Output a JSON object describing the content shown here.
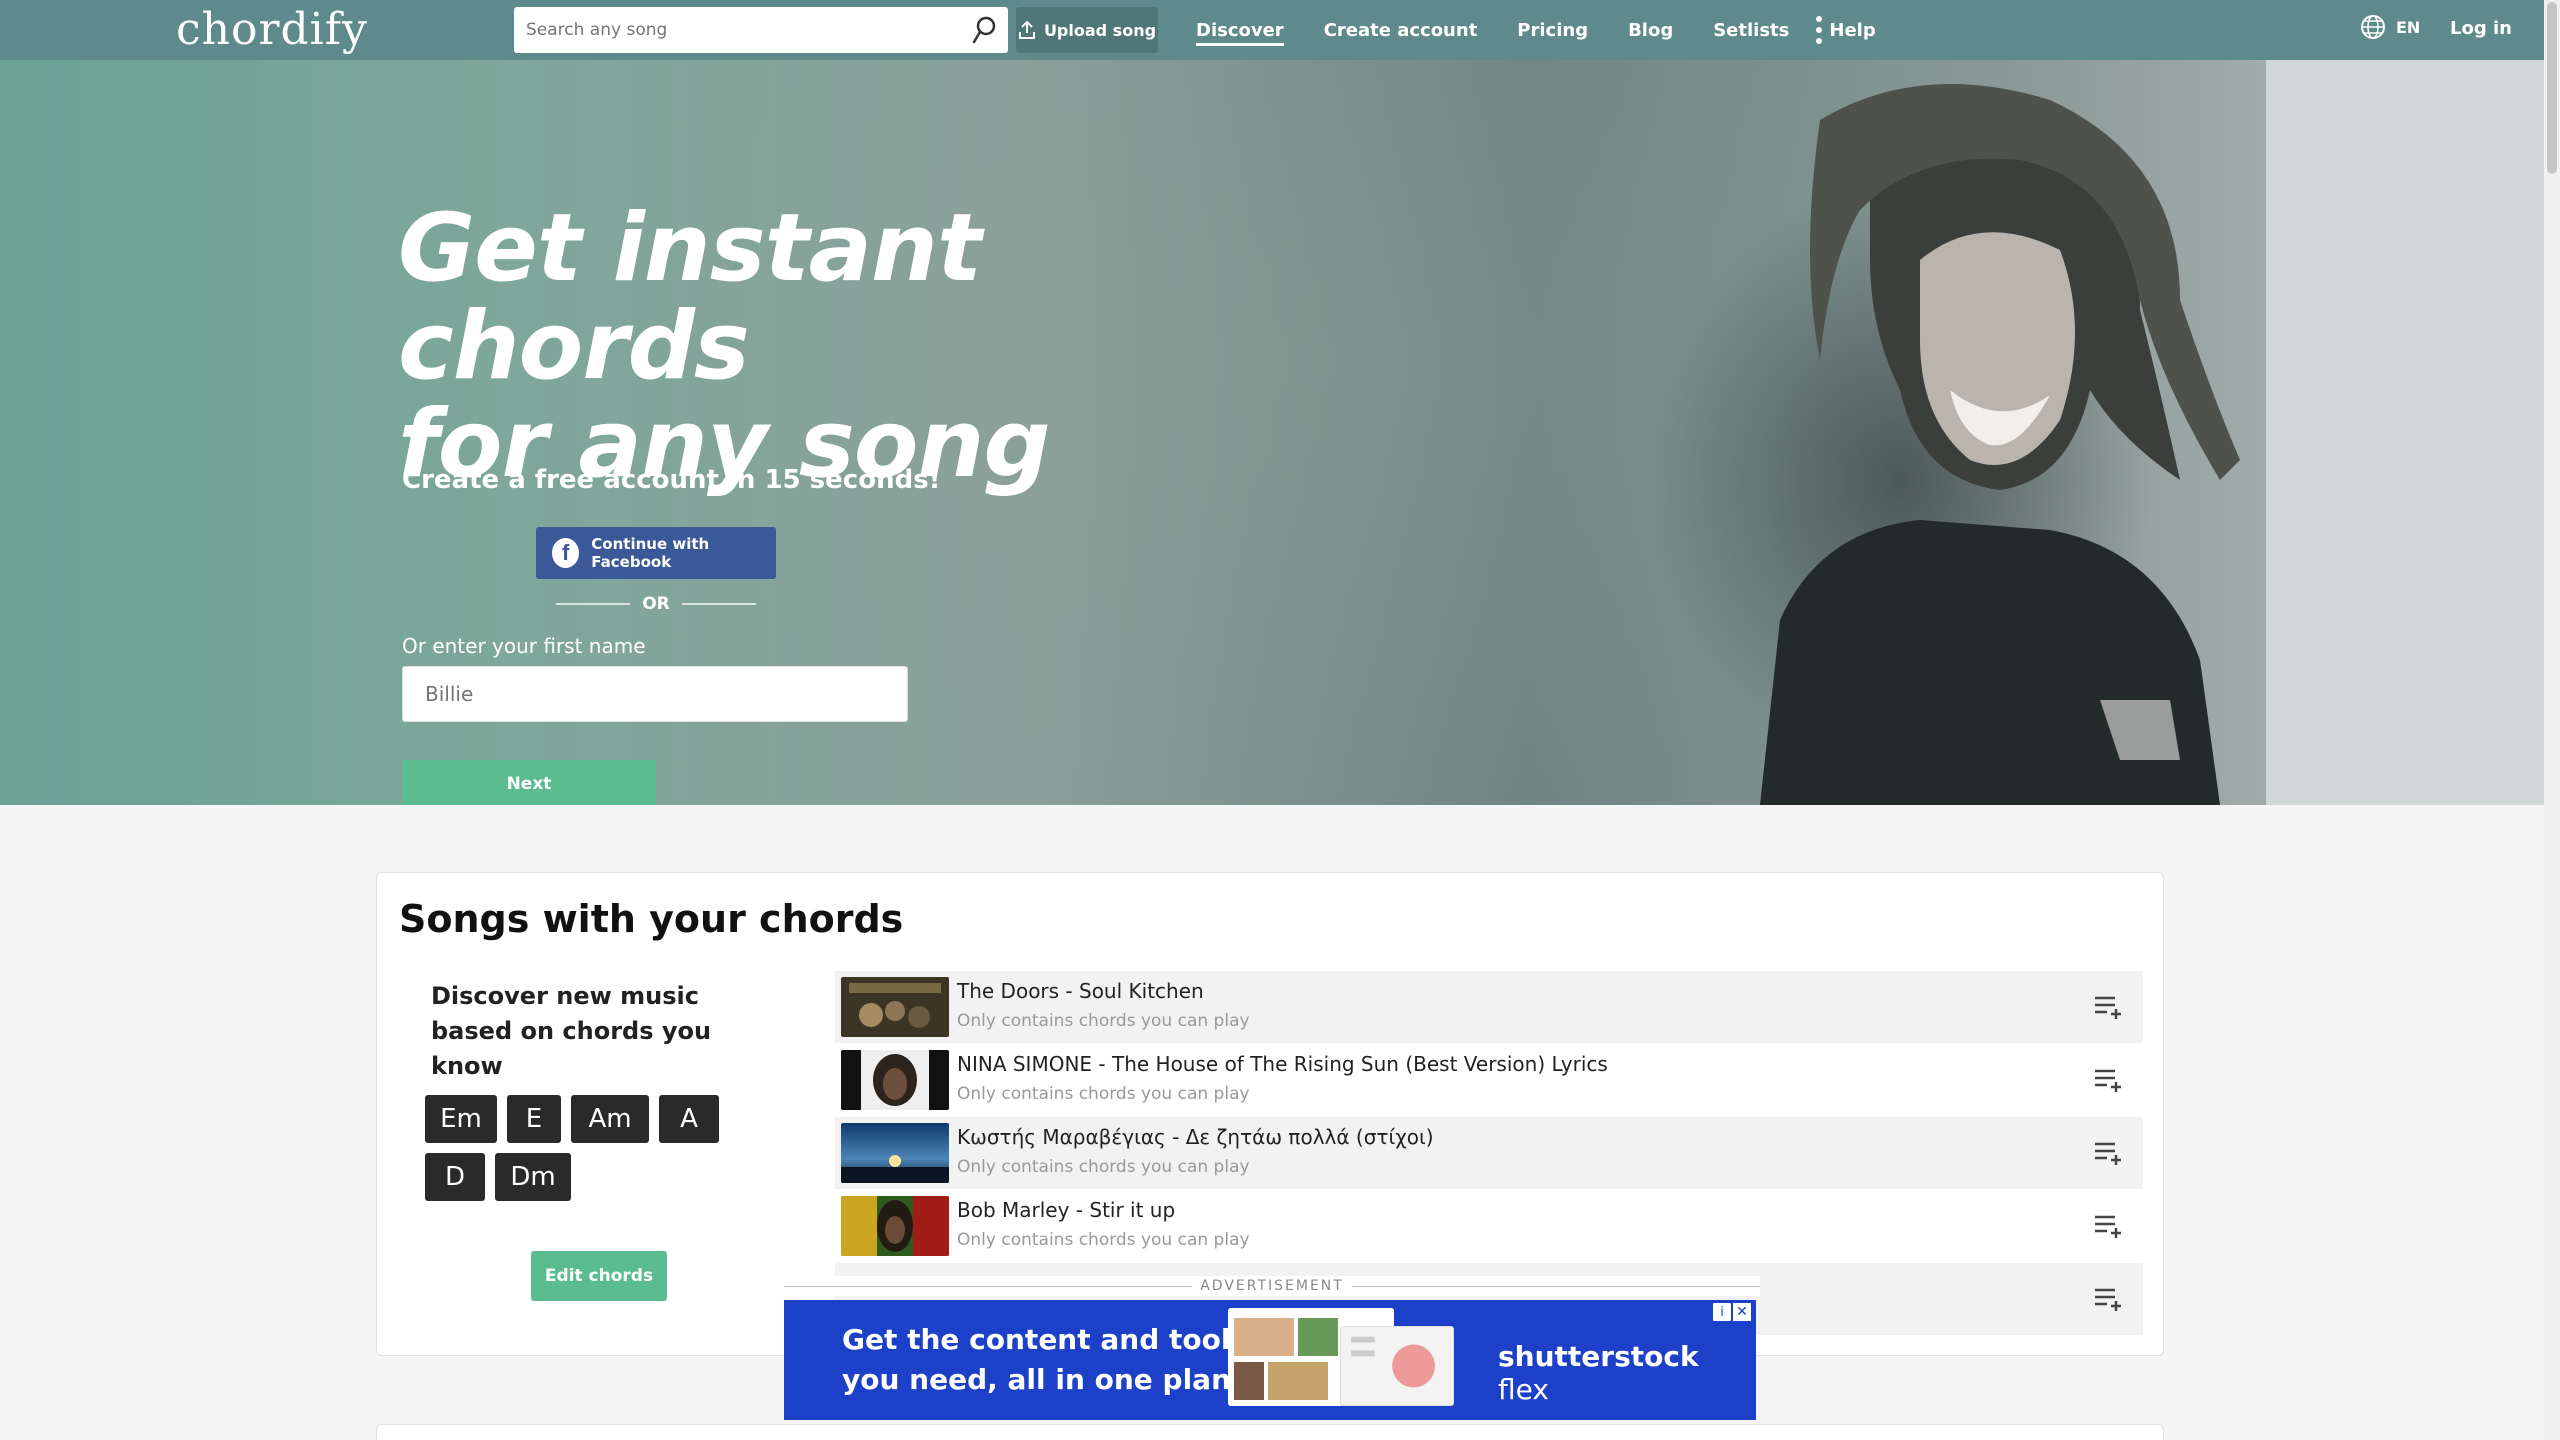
{
  "nav": {
    "logo": "chordify",
    "search_placeholder": "Search any song",
    "upload_label": "Upload song",
    "links": [
      {
        "label": "Discover",
        "active": true
      },
      {
        "label": "Create account"
      },
      {
        "label": "Pricing"
      },
      {
        "label": "Blog"
      },
      {
        "label": "Setlists"
      },
      {
        "label": "Help"
      }
    ],
    "lang": "EN",
    "login": "Log in"
  },
  "hero": {
    "title_line1": "Get instant chords",
    "title_line2": "for any song",
    "subtitle": "Create a free account in 15 seconds!",
    "facebook_label": "Continue with Facebook",
    "or_label": "OR",
    "name_label": "Or enter your first name",
    "name_placeholder": "Billie",
    "next_label": "Next"
  },
  "songs_section": {
    "title": "Songs with your chords",
    "discover_text": "Discover new music based on chords you know",
    "chords": [
      "Em",
      "E",
      "Am",
      "A",
      "D",
      "Dm"
    ],
    "edit_label": "Edit chords",
    "songs": [
      {
        "title": "The Doors - Soul Kitchen",
        "subtitle": "Only contains chords you can play"
      },
      {
        "title": "NINA SIMONE - The House of The Rising Sun (Best Version) Lyrics",
        "subtitle": "Only contains chords you can play"
      },
      {
        "title": "Κωστής Μαραβέγιας - Δε ζητάω πολλά (στίχοι)",
        "subtitle": "Only contains chords you can play"
      },
      {
        "title": "Bob Marley - Stir it up",
        "subtitle": "Only contains chords you can play"
      }
    ]
  },
  "ad": {
    "label": "ADVERTISEMENT",
    "line1": "Get the content and tools",
    "line2": "you need, all in one plan",
    "brand": "shutterstock",
    "brand_suffix": "flex",
    "close": "✕",
    "info": "i"
  },
  "colors": {
    "nav": "#5f8a8b",
    "accent_green": "#5bbd8f",
    "facebook": "#3b5998",
    "ad_blue": "#1d40c8"
  }
}
